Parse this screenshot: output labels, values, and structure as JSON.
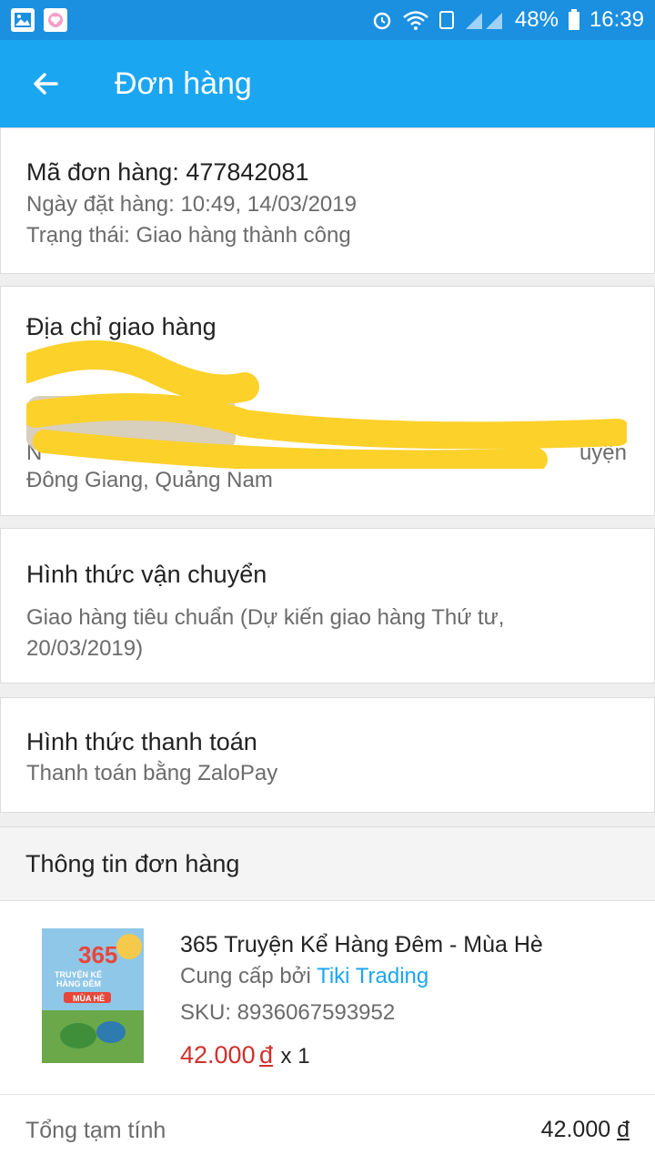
{
  "status": {
    "battery": "48%",
    "time": "16:39"
  },
  "appbar": {
    "title": "Đơn hàng"
  },
  "order": {
    "id_line": "Mã đơn hàng: 477842081",
    "date_line": "Ngày đặt hàng: 10:49, 14/03/2019",
    "status_line": "Trạng thái: Giao hàng thành công"
  },
  "address": {
    "heading": "Địa chỉ giao hàng",
    "visible_fragment_1": "N",
    "visible_fragment_2": "uyện",
    "last_line": "Đông Giang, Quảng Nam"
  },
  "shipping": {
    "heading": "Hình thức vận chuyển",
    "detail": "Giao hàng tiêu chuẩn (Dự kiến giao hàng Thứ tư, 20/03/2019)"
  },
  "payment": {
    "heading": "Hình thức thanh toán",
    "detail": "Thanh toán bằng ZaloPay"
  },
  "order_info": {
    "heading": "Thông tin đơn hàng"
  },
  "item": {
    "name": "365 Truyện Kể Hàng Đêm - Mùa Hè",
    "supplier_prefix": "Cung cấp bởi ",
    "supplier": "Tiki Trading",
    "sku": "SKU: 8936067593952",
    "price": "42.000",
    "currency": "đ",
    "qty": "x 1",
    "cover_text_1": "365",
    "cover_text_2": "TRUYỆN KỂ",
    "cover_text_3": "HÀNG ĐÊM",
    "cover_text_4": "MÙA HÈ"
  },
  "summary": {
    "label": "Tổng tạm tính",
    "value": "42.000",
    "currency": "đ"
  }
}
